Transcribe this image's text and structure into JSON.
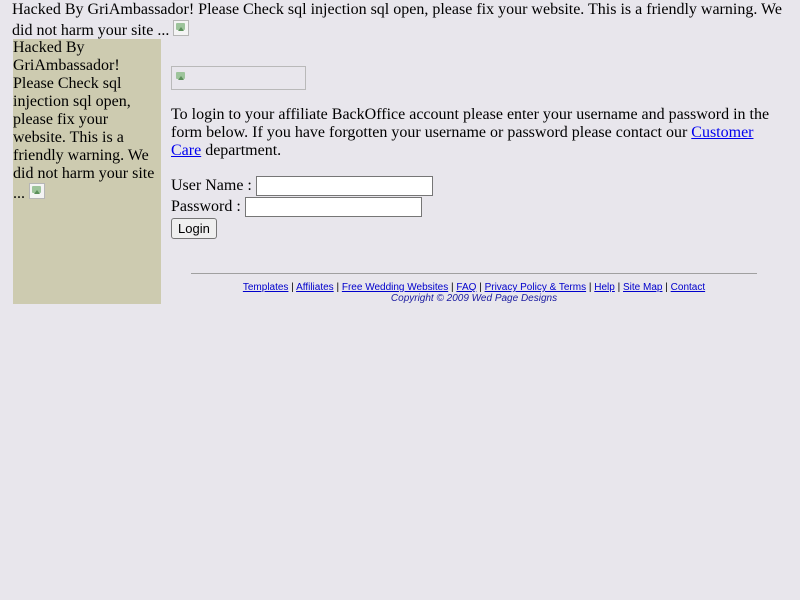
{
  "banner": {
    "text": "Hacked By GriAmbassador! Please Check sql injection sql open, please fix your website. This is a friendly warning. We did not harm your site ..."
  },
  "sidebar": {
    "text": "Hacked By GriAmbassador! Please Check sql injection sql open, please fix your website. This is a friendly warning. We did not harm your site ..."
  },
  "intro": {
    "text_before": "To login to your affiliate BackOffice account please enter your username and password in the form below. If you have forgotten your username or password please contact our ",
    "link": "Customer Care",
    "text_after": " department."
  },
  "form": {
    "username_label": "User Name :",
    "username_value": "",
    "password_label": "Password :",
    "password_value": "",
    "login_label": "Login"
  },
  "footer": {
    "links": [
      "Templates",
      "Affiliates",
      "Free Wedding Websites",
      "FAQ",
      "Privacy Policy & Terms",
      "Help",
      "Site Map",
      "Contact"
    ],
    "separator": "|",
    "copyright": "Copyright © 2009 Wed Page Designs"
  },
  "colors": {
    "page_bg": "#e8e6ec",
    "sidebar_bg": "#cdcbb0",
    "link": "#0000ee"
  },
  "icons": {
    "broken_image": "broken-image-icon"
  }
}
